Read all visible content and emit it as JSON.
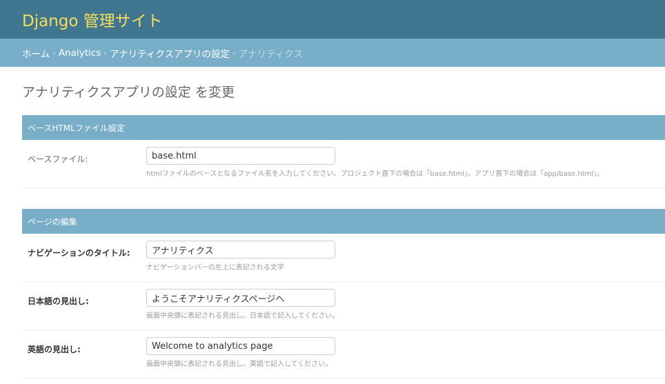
{
  "header": {
    "site_title": "Django 管理サイト"
  },
  "breadcrumbs": {
    "home": "ホーム",
    "app": "Analytics",
    "model": "アナリティクスアプリの設定",
    "current": "アナリティクス",
    "separator": "›"
  },
  "page": {
    "title": "アナリティクスアプリの設定 を変更"
  },
  "sections": {
    "base": {
      "title": "ベースHTMLファイル設定",
      "fields": {
        "base_file": {
          "label": "ベースファイル:",
          "value": "base.html",
          "help": "htmlファイルのベースとなるファイル名を入力してください。プロジェクト直下の場合は「base.html」。アプリ直下の場合は「app/base.html」。"
        }
      }
    },
    "page": {
      "title": "ページの編集",
      "fields": {
        "nav_title": {
          "label": "ナビゲーションのタイトル:",
          "value": "アナリティクス",
          "help": "ナビゲーションバーの左上に表記される文字"
        },
        "heading_ja": {
          "label": "日本語の見出し:",
          "value": "ようこそアナリティクスページへ",
          "help": "画面中央頭に表記される見出し。日本語で記入してください。"
        },
        "heading_en": {
          "label": "英語の見出し:",
          "value": "Welcome to analytics page",
          "help": "画面中央頭に表記される見出し。英語で記入してください。"
        }
      }
    }
  },
  "colors": {
    "header_bg": "#417690",
    "title_yellow": "#f5dd5d",
    "breadcrumb_bg": "#79aec8",
    "module_header_bg": "#79aec8"
  }
}
